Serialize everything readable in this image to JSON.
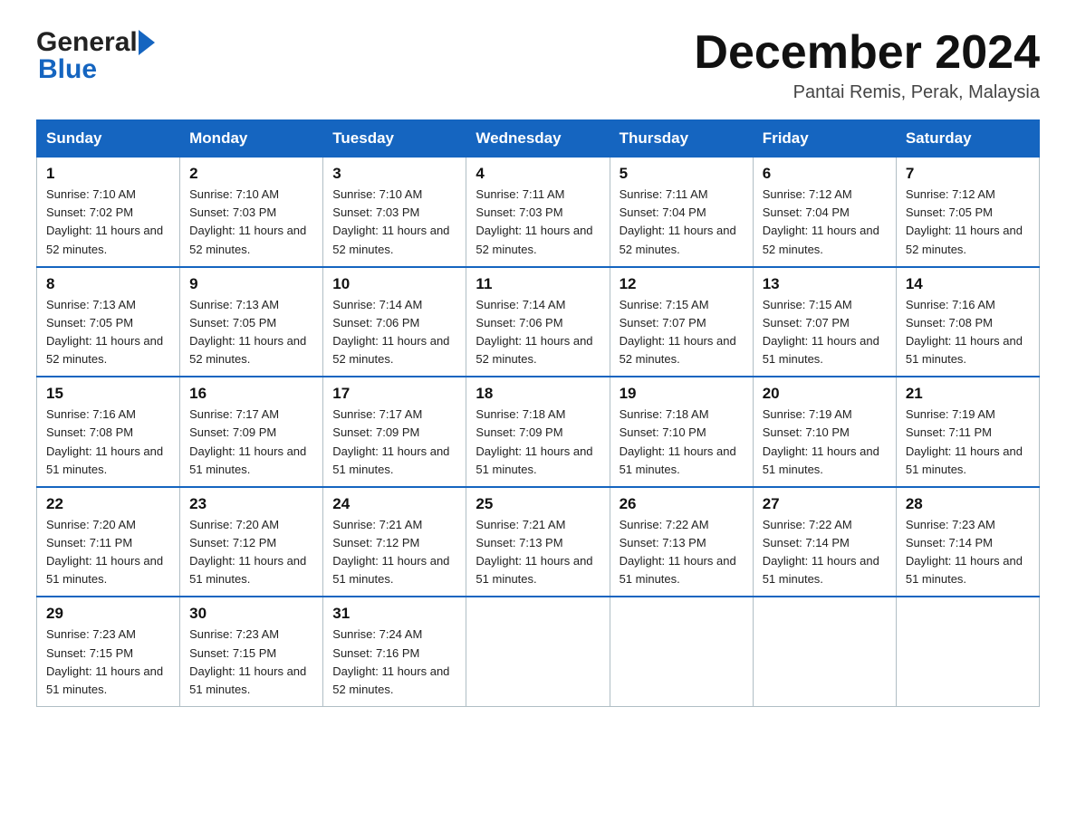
{
  "header": {
    "month_title": "December 2024",
    "location": "Pantai Remis, Perak, Malaysia",
    "logo_general": "General",
    "logo_blue": "Blue"
  },
  "days_of_week": [
    "Sunday",
    "Monday",
    "Tuesday",
    "Wednesday",
    "Thursday",
    "Friday",
    "Saturday"
  ],
  "weeks": [
    [
      {
        "day": "1",
        "sunrise": "7:10 AM",
        "sunset": "7:02 PM",
        "daylight": "11 hours and 52 minutes."
      },
      {
        "day": "2",
        "sunrise": "7:10 AM",
        "sunset": "7:03 PM",
        "daylight": "11 hours and 52 minutes."
      },
      {
        "day": "3",
        "sunrise": "7:10 AM",
        "sunset": "7:03 PM",
        "daylight": "11 hours and 52 minutes."
      },
      {
        "day": "4",
        "sunrise": "7:11 AM",
        "sunset": "7:03 PM",
        "daylight": "11 hours and 52 minutes."
      },
      {
        "day": "5",
        "sunrise": "7:11 AM",
        "sunset": "7:04 PM",
        "daylight": "11 hours and 52 minutes."
      },
      {
        "day": "6",
        "sunrise": "7:12 AM",
        "sunset": "7:04 PM",
        "daylight": "11 hours and 52 minutes."
      },
      {
        "day": "7",
        "sunrise": "7:12 AM",
        "sunset": "7:05 PM",
        "daylight": "11 hours and 52 minutes."
      }
    ],
    [
      {
        "day": "8",
        "sunrise": "7:13 AM",
        "sunset": "7:05 PM",
        "daylight": "11 hours and 52 minutes."
      },
      {
        "day": "9",
        "sunrise": "7:13 AM",
        "sunset": "7:05 PM",
        "daylight": "11 hours and 52 minutes."
      },
      {
        "day": "10",
        "sunrise": "7:14 AM",
        "sunset": "7:06 PM",
        "daylight": "11 hours and 52 minutes."
      },
      {
        "day": "11",
        "sunrise": "7:14 AM",
        "sunset": "7:06 PM",
        "daylight": "11 hours and 52 minutes."
      },
      {
        "day": "12",
        "sunrise": "7:15 AM",
        "sunset": "7:07 PM",
        "daylight": "11 hours and 52 minutes."
      },
      {
        "day": "13",
        "sunrise": "7:15 AM",
        "sunset": "7:07 PM",
        "daylight": "11 hours and 51 minutes."
      },
      {
        "day": "14",
        "sunrise": "7:16 AM",
        "sunset": "7:08 PM",
        "daylight": "11 hours and 51 minutes."
      }
    ],
    [
      {
        "day": "15",
        "sunrise": "7:16 AM",
        "sunset": "7:08 PM",
        "daylight": "11 hours and 51 minutes."
      },
      {
        "day": "16",
        "sunrise": "7:17 AM",
        "sunset": "7:09 PM",
        "daylight": "11 hours and 51 minutes."
      },
      {
        "day": "17",
        "sunrise": "7:17 AM",
        "sunset": "7:09 PM",
        "daylight": "11 hours and 51 minutes."
      },
      {
        "day": "18",
        "sunrise": "7:18 AM",
        "sunset": "7:09 PM",
        "daylight": "11 hours and 51 minutes."
      },
      {
        "day": "19",
        "sunrise": "7:18 AM",
        "sunset": "7:10 PM",
        "daylight": "11 hours and 51 minutes."
      },
      {
        "day": "20",
        "sunrise": "7:19 AM",
        "sunset": "7:10 PM",
        "daylight": "11 hours and 51 minutes."
      },
      {
        "day": "21",
        "sunrise": "7:19 AM",
        "sunset": "7:11 PM",
        "daylight": "11 hours and 51 minutes."
      }
    ],
    [
      {
        "day": "22",
        "sunrise": "7:20 AM",
        "sunset": "7:11 PM",
        "daylight": "11 hours and 51 minutes."
      },
      {
        "day": "23",
        "sunrise": "7:20 AM",
        "sunset": "7:12 PM",
        "daylight": "11 hours and 51 minutes."
      },
      {
        "day": "24",
        "sunrise": "7:21 AM",
        "sunset": "7:12 PM",
        "daylight": "11 hours and 51 minutes."
      },
      {
        "day": "25",
        "sunrise": "7:21 AM",
        "sunset": "7:13 PM",
        "daylight": "11 hours and 51 minutes."
      },
      {
        "day": "26",
        "sunrise": "7:22 AM",
        "sunset": "7:13 PM",
        "daylight": "11 hours and 51 minutes."
      },
      {
        "day": "27",
        "sunrise": "7:22 AM",
        "sunset": "7:14 PM",
        "daylight": "11 hours and 51 minutes."
      },
      {
        "day": "28",
        "sunrise": "7:23 AM",
        "sunset": "7:14 PM",
        "daylight": "11 hours and 51 minutes."
      }
    ],
    [
      {
        "day": "29",
        "sunrise": "7:23 AM",
        "sunset": "7:15 PM",
        "daylight": "11 hours and 51 minutes."
      },
      {
        "day": "30",
        "sunrise": "7:23 AM",
        "sunset": "7:15 PM",
        "daylight": "11 hours and 51 minutes."
      },
      {
        "day": "31",
        "sunrise": "7:24 AM",
        "sunset": "7:16 PM",
        "daylight": "11 hours and 52 minutes."
      },
      null,
      null,
      null,
      null
    ]
  ],
  "labels": {
    "sunrise": "Sunrise:",
    "sunset": "Sunset:",
    "daylight": "Daylight:"
  }
}
